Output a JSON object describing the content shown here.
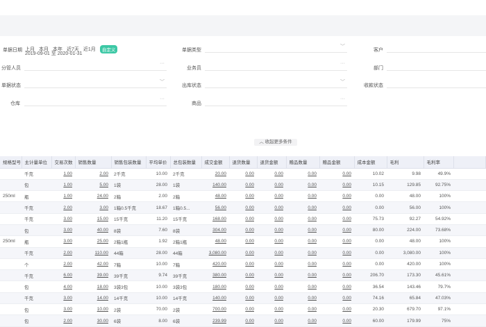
{
  "filters": {
    "date_label": "单据日期",
    "quick": [
      "上月",
      "本月",
      "本年",
      "近7天",
      "近1月"
    ],
    "custom": "自定义",
    "range": "2019-09-01 至 2020-01-31",
    "bill_type": "单据类型",
    "customer": "客户",
    "manager": "分管人员",
    "salesman": "业务员",
    "department": "部门",
    "bill_status": "单据状态",
    "outbound_status": "出库状态",
    "payment_status": "收款状态",
    "warehouse": "仓库",
    "product": "商品",
    "collapse": "收起更多条件"
  },
  "table": {
    "headers": [
      "规格型号",
      "主计量单位",
      "交易次数",
      "销售数量",
      "销售包装数量",
      "平均单价",
      "总包装数量",
      "成交金额",
      "退货数量",
      "退货金额",
      "赠品数量",
      "赠品金额",
      "成本金额",
      "毛利",
      "毛利率",
      ""
    ],
    "rows": [
      [
        "",
        "千克",
        "1.00",
        "2.00",
        "2千克",
        "10.00",
        "2千克",
        "20.00",
        "0.00",
        "0.00",
        "0.00",
        "0.00",
        "10.02",
        "9.98",
        "49.9%"
      ],
      [
        "",
        "包",
        "1.00",
        "5.00",
        "1袋",
        "28.00",
        "1袋",
        "140.00",
        "0.00",
        "0.00",
        "0.00",
        "0.00",
        "10.15",
        "129.85",
        "92.75%"
      ],
      [
        "250ml",
        "瓶",
        "1.00",
        "24.00",
        "2箱",
        "2.00",
        "2箱",
        "48.00",
        "0.00",
        "0.00",
        "0.00",
        "0.00",
        "0.00",
        "48.00",
        "100%"
      ],
      [
        "",
        "千克",
        "2.00",
        "3.00",
        "1箱0.5千克",
        "18.67",
        "1箱0.5...",
        "56.00",
        "0.00",
        "0.00",
        "0.00",
        "0.00",
        "0.00",
        "56.00",
        "100%"
      ],
      [
        "",
        "千克",
        "3.00",
        "15.00",
        "15千克",
        "11.20",
        "15千克",
        "168.00",
        "0.00",
        "0.00",
        "0.00",
        "0.00",
        "75.73",
        "92.27",
        "54.92%"
      ],
      [
        "",
        "包",
        "3.00",
        "40.00",
        "8袋",
        "7.60",
        "8袋",
        "304.00",
        "0.00",
        "0.00",
        "0.00",
        "0.00",
        "80.00",
        "224.00",
        "73.68%"
      ],
      [
        "250ml",
        "瓶",
        "3.00",
        "25.00",
        "2箱1瓶",
        "1.92",
        "2箱1瓶",
        "48.00",
        "0.00",
        "0.00",
        "0.00",
        "0.00",
        "0.00",
        "48.00",
        "100%"
      ],
      [
        "",
        "千克",
        "2.00",
        "110.00",
        "44箱",
        "28.00",
        "44箱",
        "3,080.00",
        "0.00",
        "0.00",
        "0.00",
        "0.00",
        "0.00",
        "3,080.00",
        "100%"
      ],
      [
        "",
        "个",
        "2.00",
        "42.00",
        "7箱",
        "10.00",
        "7箱",
        "420.00",
        "0.00",
        "0.00",
        "0.00",
        "0.00",
        "0.00",
        "420.00",
        "100%"
      ],
      [
        "",
        "千克",
        "6.00",
        "39.00",
        "39千克",
        "9.74",
        "39千克",
        "380.00",
        "0.00",
        "0.00",
        "0.00",
        "0.00",
        "206.70",
        "173.30",
        "45.61%"
      ],
      [
        "",
        "包",
        "4.00",
        "18.00",
        "3袋3包",
        "10.00",
        "3袋3包",
        "180.00",
        "0.00",
        "0.00",
        "0.00",
        "0.00",
        "36.54",
        "143.46",
        "79.7%"
      ],
      [
        "",
        "千克",
        "3.00",
        "14.00",
        "14千克",
        "10.00",
        "14千克",
        "140.00",
        "0.00",
        "0.00",
        "0.00",
        "0.00",
        "74.16",
        "65.84",
        "47.03%"
      ],
      [
        "",
        "包",
        "3.00",
        "10.00",
        "2袋",
        "70.00",
        "2袋",
        "700.00",
        "0.00",
        "0.00",
        "0.00",
        "0.00",
        "20.30",
        "679.70",
        "97.1%"
      ],
      [
        "",
        "包",
        "2.00",
        "30.00",
        "6袋",
        "8.00",
        "6袋",
        "239.99",
        "0.00",
        "0.00",
        "0.00",
        "0.00",
        "60.00",
        "179.99",
        "75%"
      ]
    ]
  },
  "colors": {
    "accent": "#3cc8a5",
    "header_bg": "#eef0f7"
  }
}
